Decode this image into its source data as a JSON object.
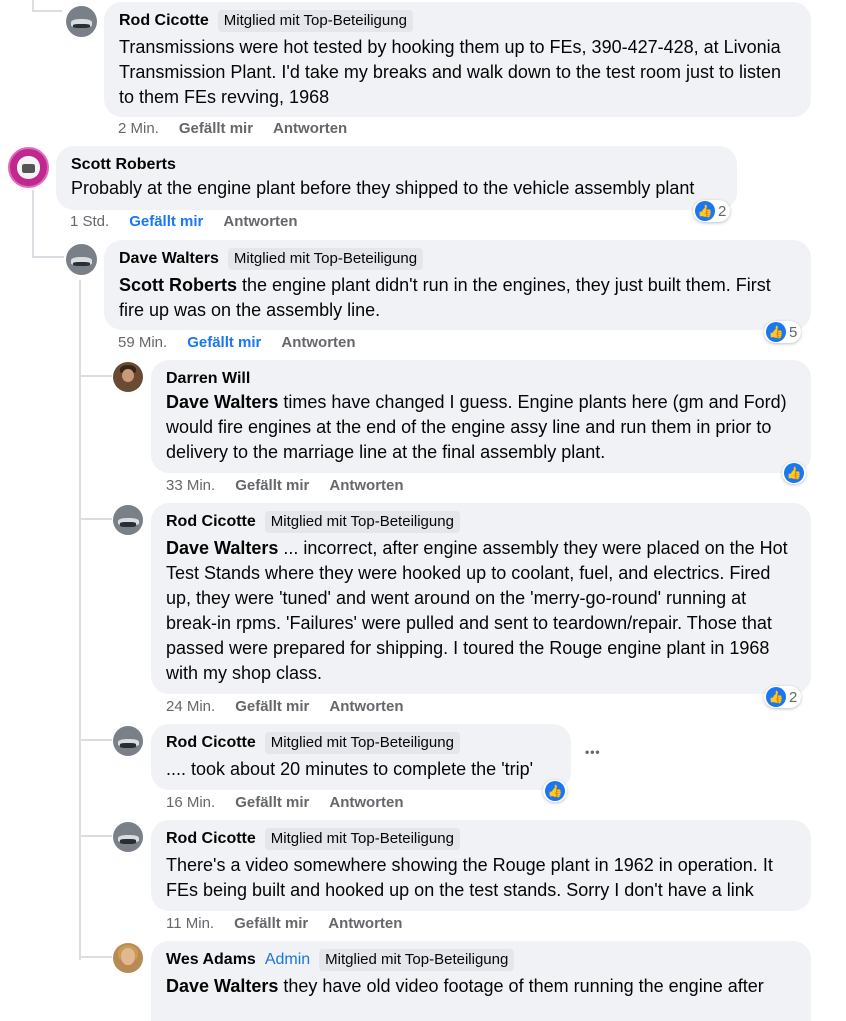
{
  "like_label": "Gefällt mir",
  "reply_label": "Antworten",
  "badge_top": "Mitglied mit Top-Beteiligung",
  "admin_label": "Admin",
  "comments": [
    {
      "author": "Rod Cicotte",
      "text": "Transmissions were hot tested by hooking them up to FEs, 390-427-428, at Livonia Transmission Plant. I'd take my breaks and walk down to the test room just to listen to them FEs revving, 1968",
      "time": "2 Min."
    },
    {
      "author": "Scott Roberts",
      "text": "Probably at the engine plant before they shipped to the vehicle assembly plant",
      "time": "1 Std.",
      "reactions": "2"
    },
    {
      "author": "Dave Walters",
      "mention": "Scott Roberts",
      "text": " the engine plant didn't run in the engines, they just built them. First fire up was on the assembly line.",
      "time": "59 Min.",
      "reactions": "5"
    },
    {
      "author": "Darren Will",
      "mention": "Dave Walters",
      "text": " times have changed I guess. Engine plants here (gm and Ford) would fire engines at the end of the engine assy line and run them in prior to delivery to the marriage line at the final assembly plant.",
      "time": "33 Min."
    },
    {
      "author": "Rod Cicotte",
      "mention": "Dave Walters",
      "text": " ... incorrect, after engine assembly they were placed on the Hot Test Stands where they were hooked up to coolant, fuel, and electrics. Fired up, they were 'tuned' and went around on the 'merry-go-round' running at break-in rpms. 'Failures' were pulled and sent to teardown/repair. Those that passed were prepared for shipping. I toured the Rouge engine plant in 1968 with my shop class.",
      "time": "24 Min.",
      "reactions": "2"
    },
    {
      "author": "Rod Cicotte",
      "text": ".... took about 20 minutes to complete the 'trip'",
      "time": "16 Min."
    },
    {
      "author": "Rod Cicotte",
      "text": "There's a video somewhere showing the Rouge plant in 1962 in operation. It FEs being built and hooked up on the test stands. Sorry I don't have a link",
      "time": "11 Min."
    },
    {
      "author": "Wes Adams",
      "mention": "Dave Walters",
      "text": " they have old video footage of them running the engine after"
    }
  ],
  "more_options": "•••",
  "like_icon": "thumbs-up-icon",
  "accent": "#1877f2"
}
